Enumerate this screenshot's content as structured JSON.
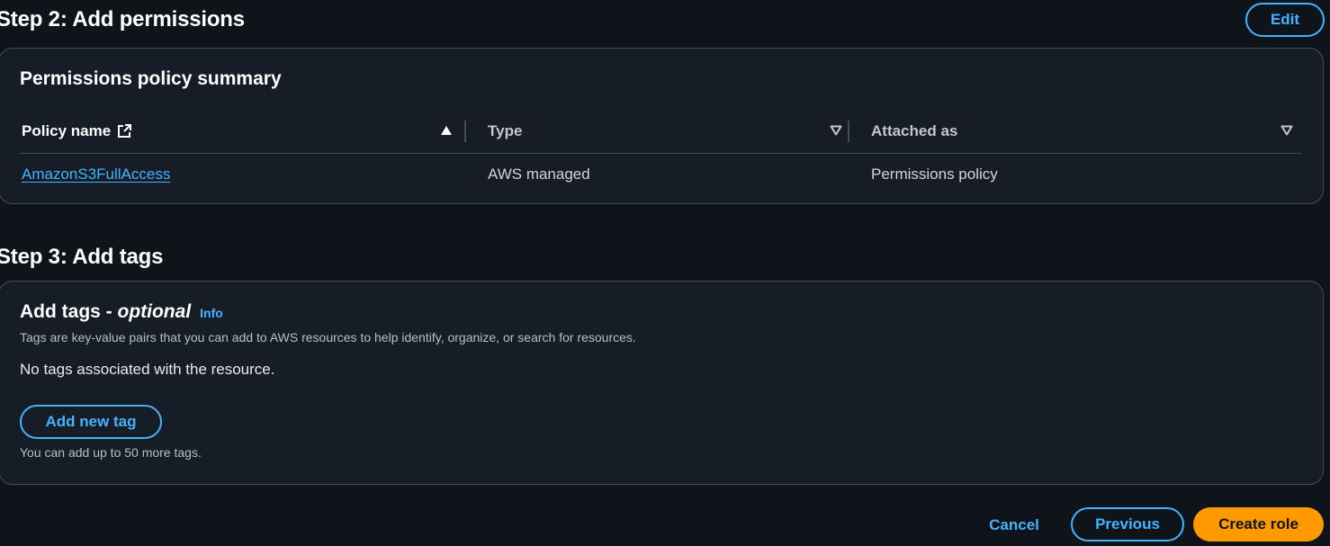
{
  "step2": {
    "title": "Step 2: Add permissions",
    "edit_label": "Edit",
    "summary_title": "Permissions policy summary",
    "columns": [
      "Policy name",
      "Type",
      "Attached as"
    ],
    "rows": [
      {
        "policy_name": "AmazonS3FullAccess",
        "type": "AWS managed",
        "attached_as": "Permissions policy"
      }
    ],
    "sort": {
      "policy_name": "ascending",
      "type": "none",
      "attached_as": "none"
    }
  },
  "step3": {
    "title": "Step 3: Add tags",
    "section_title": "Add tags - ",
    "section_title_optional": "optional",
    "info_label": "Info",
    "description": "Tags are key-value pairs that you can add to AWS resources to help identify, organize, or search for resources.",
    "empty_text": "No tags associated with the resource.",
    "add_tag_label": "Add new tag",
    "limit_text": "You can add up to 50 more tags."
  },
  "footer": {
    "cancel_label": "Cancel",
    "previous_label": "Previous",
    "create_label": "Create role"
  },
  "colors": {
    "background": "#0f141a",
    "container": "#161d26",
    "link": "#42b4ff",
    "primary": "#ff9900"
  },
  "icons": [
    "external-link-icon",
    "sort-ascending-icon",
    "sort-descending-icon"
  ]
}
